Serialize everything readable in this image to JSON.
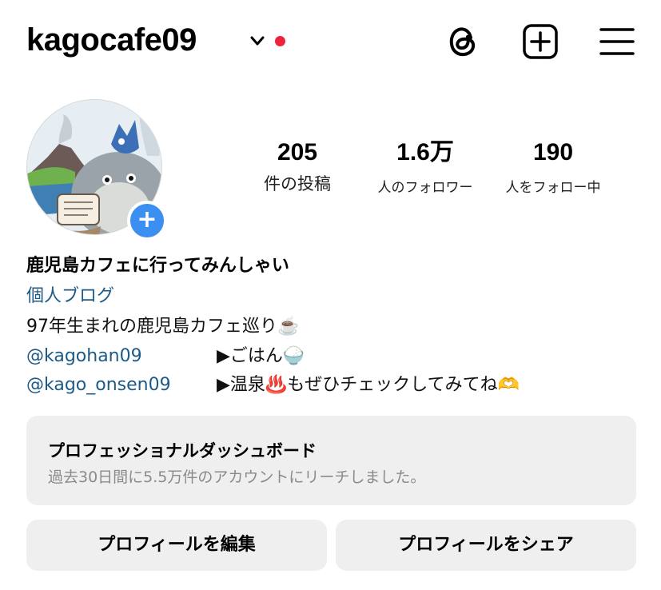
{
  "header": {
    "username": "kagocafe09",
    "icons": [
      "chevron-down-icon",
      "notification-dot",
      "threads-icon",
      "new-post-icon",
      "menu-icon"
    ],
    "notification_dot_color": "#ef233c"
  },
  "profile": {
    "avatar_badge": "+",
    "stats": [
      {
        "value": "205",
        "label": "件の投稿"
      },
      {
        "value": "1.6万",
        "label": "人のフォロワー"
      },
      {
        "value": "190",
        "label": "人をフォロー中"
      }
    ],
    "display_name": "鹿児島カフェに行ってみんしゃい",
    "category": "個人ブログ",
    "bio_line": "97年生まれの鹿児島カフェ巡り☕️",
    "links": [
      {
        "handle": "@kagohan09",
        "desc": "▶︎ごはん🍚"
      },
      {
        "handle": "@kago_onsen09",
        "desc": "▶︎温泉♨️もぜひチェックしてみてね🫶"
      }
    ]
  },
  "dashboard": {
    "title": "プロフェッショナルダッシュボード",
    "subtitle": "過去30日間に5.5万件のアカウントにリーチしました。"
  },
  "buttons": {
    "edit": "プロフィールを編集",
    "share": "プロフィールをシェア"
  },
  "colors": {
    "link": "#1d5a86",
    "badge": "#3b8ff0",
    "button_bg": "#efefef"
  }
}
